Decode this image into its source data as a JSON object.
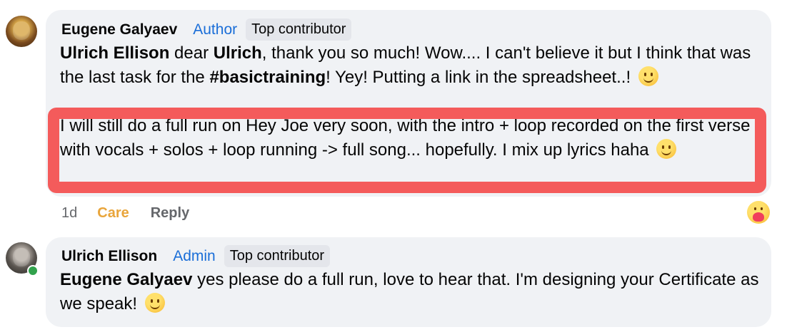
{
  "comments": [
    {
      "author": "Eugene Galyaev",
      "role": "Author",
      "badge": "Top contributor",
      "mention": "Ulrich Ellison",
      "text_part1": " dear ",
      "text_bold2": "Ulrich",
      "text_part2": ", thank you so much! Wow.... I can't believe it but I think that was the last task for the ",
      "hashtag": "#basictraining",
      "text_part3": "! Yey! Putting a link in the spreadsheet..!",
      "highlighted_text": "I will still do a full run on Hey Joe very soon, with the intro + loop recorded on the first verse with vocals + solos + loop running -> full song... hopefully. I mix up lyrics haha",
      "time": "1d",
      "reaction_label": "Care",
      "reply_label": "Reply",
      "reaction_icon": "care-reaction-icon",
      "colors": {
        "role": "#1a6ed8",
        "care": "#e9a53b",
        "highlight_border": "#f45b5b",
        "bubble": "#f0f2f5"
      }
    },
    {
      "author": "Ulrich Ellison",
      "role": "Admin",
      "badge": "Top contributor",
      "mention": "Eugene Galyaev",
      "text": " yes please do a full run, love to hear that. I'm designing your Certificate as we speak!",
      "online": true
    }
  ]
}
